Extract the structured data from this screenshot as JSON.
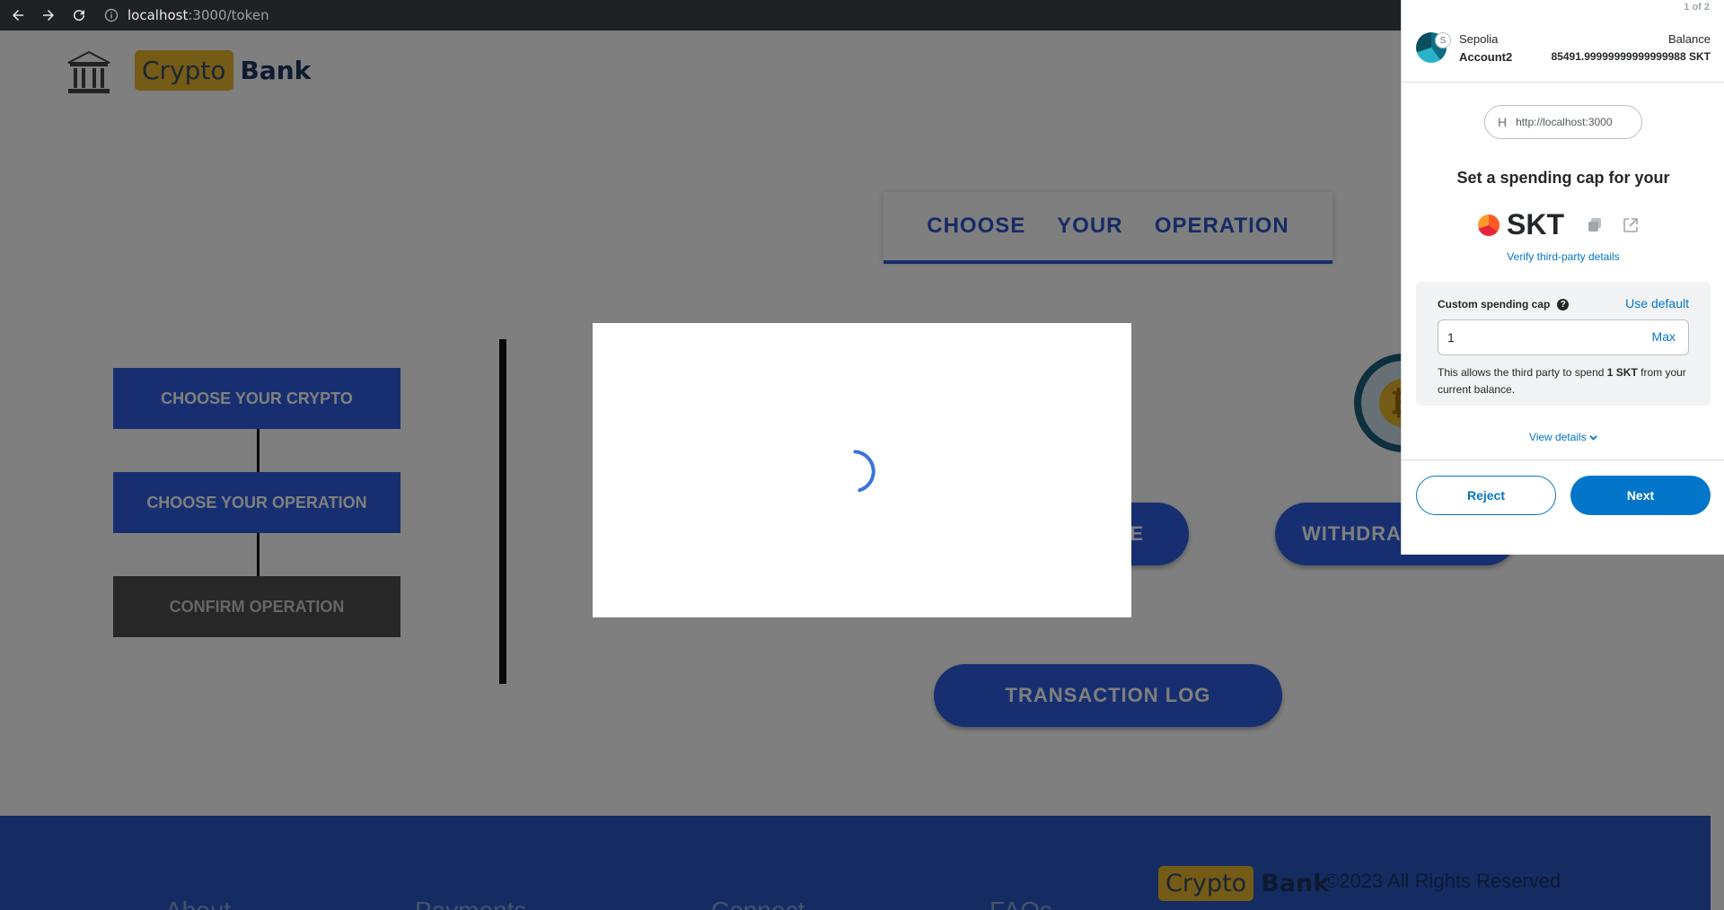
{
  "browser": {
    "url_host": "localhost",
    "url_path": ":3000/token",
    "icons": [
      "back-arrow-icon",
      "forward-arrow-icon",
      "reload-icon",
      "info-icon"
    ]
  },
  "site": {
    "logo_crypto": "Crypto",
    "logo_bank": "Bank",
    "op_header": "CHOOSE  YOUR  OPERATION",
    "steps": [
      "CHOOSE YOUR CRYPTO",
      "CHOOSE YOUR OPERATION",
      "CONFIRM OPERATION"
    ],
    "pills": {
      "deposit_partial": "E",
      "withdraw_partial": "WITHDRA",
      "transaction_log": "TRANSACTION LOG"
    },
    "coin_glyph": "₿",
    "footer": {
      "links": [
        "About",
        "Payments",
        "Connect",
        "FAQs"
      ],
      "logo_crypto": "Crypto",
      "logo_bank": "Bank",
      "copyright": "©2023 All Rights Reserved"
    }
  },
  "wallet": {
    "pager": "1 of 2",
    "network": "Sepolia",
    "network_badge": "S",
    "account": "Account2",
    "balance_label": "Balance",
    "balance_value": "85491.99999999999999988 SKT",
    "origin_initial": "H",
    "origin_url": "http://localhost:3000",
    "title": "Set a spending cap for your",
    "token_symbol": "SKT",
    "verify_link": "Verify third-party details",
    "cap_label": "Custom spending cap",
    "help_glyph": "?",
    "use_default": "Use default",
    "cap_value": "1",
    "max_label": "Max",
    "allow_prefix": "This allows the third party to spend ",
    "allow_amount": "1 SKT",
    "allow_suffix": " from your current balance.",
    "view_details": "View details",
    "reject": "Reject",
    "next": "Next",
    "accent_color": "#0376c9"
  },
  "colors": {
    "primary_blue": "#2f5fe0",
    "header_blue": "#2c56c9",
    "footer_blue": "#2a58c7",
    "logo_gold": "#e8b62c",
    "overlay": "rgba(0,0,0,0.5)"
  }
}
